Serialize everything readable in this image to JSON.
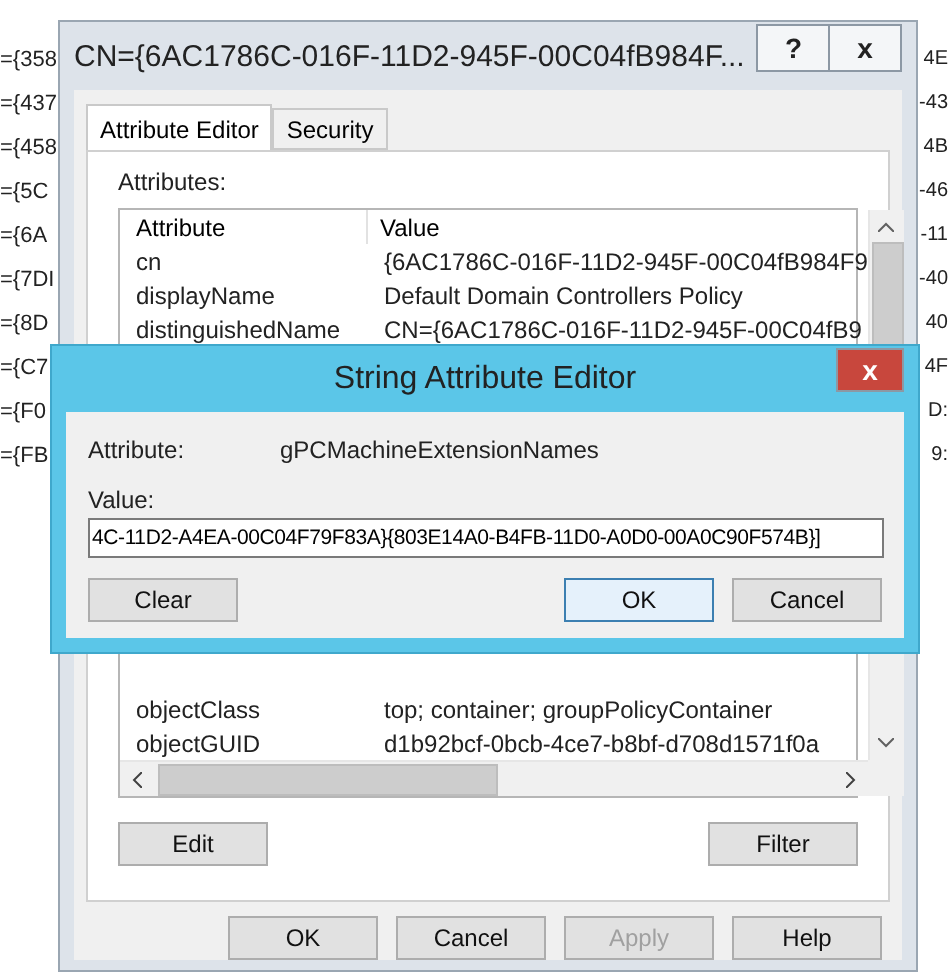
{
  "background_list": {
    "rows": [
      {
        "column_1": "={358",
        "column_3": "4E"
      },
      {
        "column_1": "={437",
        "column_3": "-43"
      },
      {
        "column_1": "={458",
        "column_3": "4B"
      },
      {
        "column_1": "={5C",
        "column_3": "-46"
      },
      {
        "column_1": "={6A",
        "column_3": "-11"
      },
      {
        "column_1": "={7DI",
        "column_3": "-40"
      },
      {
        "column_1": "={8D",
        "column_3": "40"
      },
      {
        "column_1": "={C7",
        "column_3": "4F"
      },
      {
        "column_1": "={F0",
        "column_3": "D:"
      },
      {
        "column_1": "={FB",
        "column_3": "9:"
      }
    ]
  },
  "properties_dialog": {
    "title": "CN={6AC1786C-016F-11D2-945F-00C04fB984F...",
    "title_buttons": [
      "?",
      "x"
    ],
    "tabs": [
      {
        "label": "Attribute Editor",
        "selected": true
      },
      {
        "label": "Security",
        "selected": false
      }
    ],
    "attributes_label": "Attributes:",
    "table": {
      "columns": [
        "Attribute",
        "Value"
      ],
      "top_rows": [
        {
          "attribute": "cn",
          "value": "{6AC1786C-016F-11D2-945F-00C04fB984F9"
        },
        {
          "attribute": "displayName",
          "value": "Default Domain Controllers Policy"
        },
        {
          "attribute": "distinguishedName",
          "value": "CN={6AC1786C-016F-11D2-945F-00C04fB9"
        }
      ],
      "bottom_rows": [
        {
          "attribute": "objectClass",
          "value": "top; container; groupPolicyContainer"
        },
        {
          "attribute": "objectGUID",
          "value": "d1b92bcf-0bcb-4ce7-b8bf-d708d1571f0a"
        }
      ]
    },
    "list_buttons": [
      "Edit",
      "Filter"
    ],
    "buttons": [
      {
        "label": "OK",
        "disabled": false
      },
      {
        "label": "Cancel",
        "disabled": false
      },
      {
        "label": "Apply",
        "disabled": true
      },
      {
        "label": "Help",
        "disabled": false
      }
    ]
  },
  "string_editor": {
    "title": "String Attribute Editor",
    "close": "x",
    "attribute_label": "Attribute:",
    "attribute_value": "gPCMachineExtensionNames",
    "value_label": "Value:",
    "value": "4C-11D2-A4EA-00C04F79F83A}{803E14A0-B4FB-11D0-A0D0-00A0C90F574B}]",
    "buttons": [
      {
        "label": "Clear",
        "default": false
      },
      {
        "label": "OK",
        "default": true
      },
      {
        "label": "Cancel",
        "default": false
      }
    ]
  }
}
